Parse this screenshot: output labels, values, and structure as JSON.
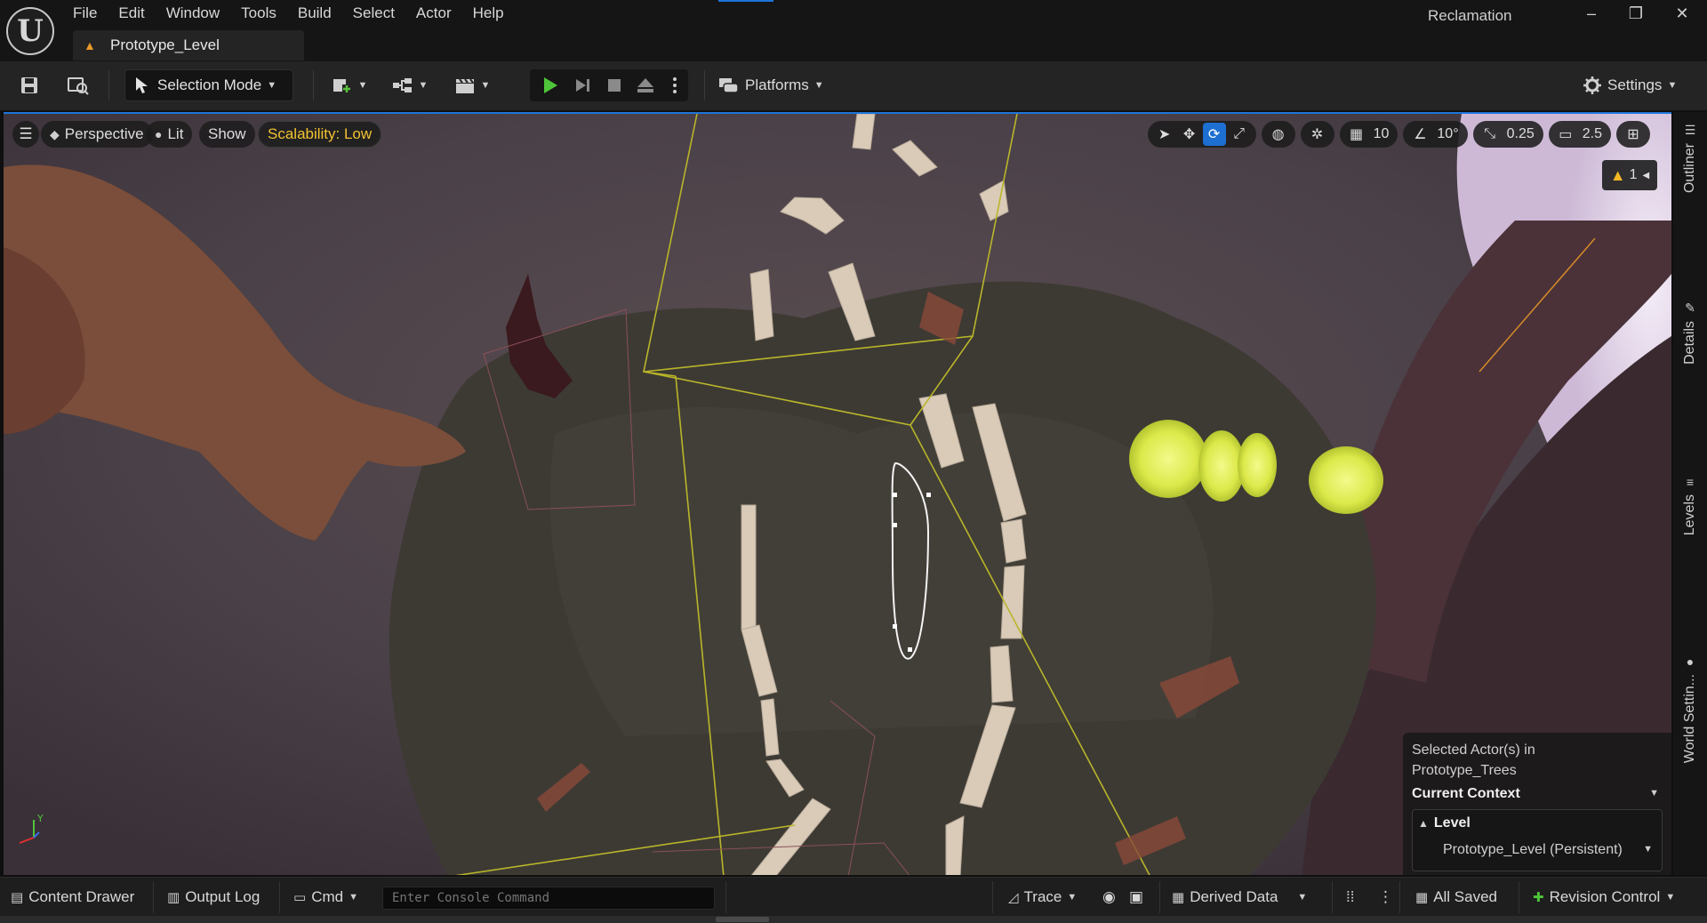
{
  "app": {
    "name": "Reclamation",
    "level_tab": "Prototype_Level"
  },
  "menu": [
    "File",
    "Edit",
    "Window",
    "Tools",
    "Build",
    "Select",
    "Actor",
    "Help"
  ],
  "window_controls": [
    "minimize-icon",
    "restore-icon",
    "close-icon"
  ],
  "toolbar": {
    "selection_mode": "Selection Mode",
    "platforms": "Platforms",
    "settings": "Settings"
  },
  "viewport": {
    "perspective": "Perspective",
    "lit": "Lit",
    "show": "Show",
    "scalability": "Scalability: Low",
    "grid_size": "10",
    "rotation_snap": "10°",
    "scale_snap": "0.25",
    "camera_speed": "2.5",
    "warning_count": "1",
    "axis_label": "Y",
    "accent_color": "#1d6fd1",
    "glow_color": "#e9f25a"
  },
  "context": {
    "selected_line1": "Selected Actor(s) in",
    "selected_line2": "Prototype_Trees",
    "title": "Current Context",
    "level_header": "Level",
    "level_value": "Prototype_Level (Persistent)"
  },
  "side_tabs": [
    "Outliner",
    "Details",
    "Levels",
    "World Settin..."
  ],
  "statusbar": {
    "content_drawer": "Content Drawer",
    "output_log": "Output Log",
    "cmd": "Cmd",
    "console_placeholder": "Enter Console Command",
    "trace": "Trace",
    "derived_data": "Derived Data",
    "all_saved": "All Saved",
    "revision_control": "Revision Control"
  }
}
